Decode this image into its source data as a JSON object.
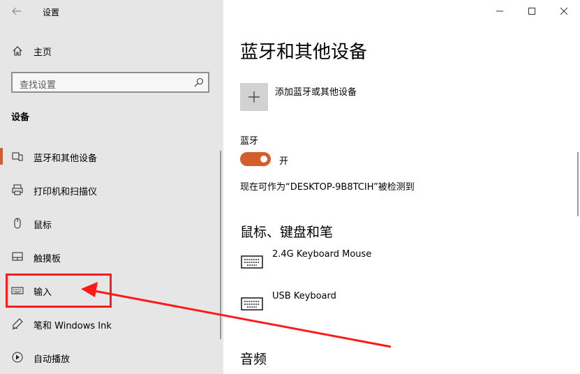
{
  "window": {
    "title": "设置",
    "controls": [
      "minimize",
      "maximize",
      "close"
    ]
  },
  "sidebar": {
    "home_label": "主页",
    "search_placeholder": "查找设置",
    "section_heading": "设备",
    "items": [
      {
        "label": "蓝牙和其他设备",
        "icon": "bluetooth-devices-icon",
        "active": true
      },
      {
        "label": "打印机和扫描仪",
        "icon": "printer-icon",
        "active": false
      },
      {
        "label": "鼠标",
        "icon": "mouse-icon",
        "active": false
      },
      {
        "label": "触摸板",
        "icon": "touchpad-icon",
        "active": false
      },
      {
        "label": "输入",
        "icon": "keyboard-icon",
        "active": false
      },
      {
        "label": "笔和 Windows Ink",
        "icon": "pen-icon",
        "active": false
      },
      {
        "label": "自动播放",
        "icon": "autoplay-icon",
        "active": false
      }
    ]
  },
  "main": {
    "title": "蓝牙和其他设备",
    "add_device_label": "添加蓝牙或其他设备",
    "bluetooth": {
      "heading": "蓝牙",
      "toggle_state": "开",
      "is_on": true,
      "discoverable_text": "现在可作为“DESKTOP-9B8TCIH”被检测到"
    },
    "mouse_keyboard_section": {
      "heading": "鼠标、键盘和笔",
      "devices": [
        {
          "name": "2.4G Keyboard Mouse",
          "icon": "keyboard-icon"
        },
        {
          "name": "USB Keyboard",
          "icon": "keyboard-icon"
        }
      ]
    },
    "audio_heading": "音频"
  },
  "colors": {
    "accent": "#d35e2b",
    "sidebar_bg": "#e6e6e6",
    "annotation": "#ff1a1a"
  }
}
